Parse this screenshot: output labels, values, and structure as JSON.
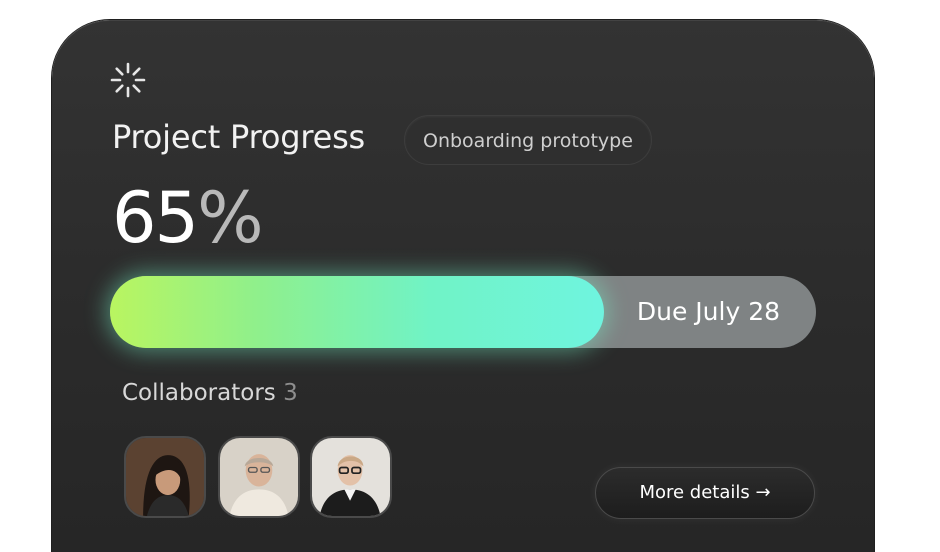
{
  "card": {
    "logo_icon": "sparkle-loader-icon",
    "title": "Project Progress",
    "project_tag": "Onboarding prototype",
    "progress": {
      "value_number": "65",
      "value_symbol": "%",
      "fraction": 0.65,
      "due_label": "Due July 28",
      "fill_colors": [
        "#b9f560",
        "#70f3c6",
        "#6ff4df"
      ]
    },
    "collaborators": {
      "label": "Collaborators",
      "count": "3",
      "avatars": [
        "avatar-woman",
        "avatar-man-bald",
        "avatar-man-glasses"
      ]
    },
    "details_button": {
      "label": "More details →"
    }
  },
  "colors": {
    "card_background": "#2b2b2b",
    "track": "#7f8384",
    "accent_start": "#b9f560",
    "accent_end": "#6ff4df"
  }
}
